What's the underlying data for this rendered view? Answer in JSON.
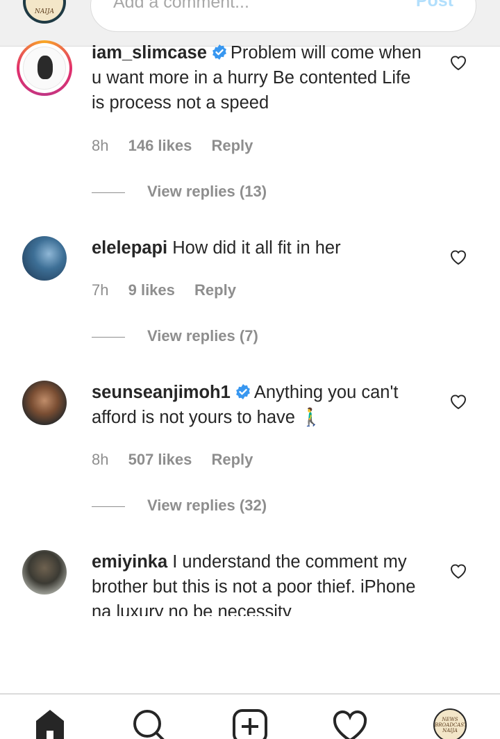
{
  "top_bar": {
    "placeholder": "Add a comment...",
    "post_label": "Post",
    "avatar_text": "NAIJA"
  },
  "comments": [
    {
      "username": "iam_slimcase",
      "verified": true,
      "text": "Problem will come when u want more in a hurry Be contented Life is process not a speed",
      "time": "8h",
      "likes": "146 likes",
      "reply": "Reply",
      "view_replies": "View replies (13)"
    },
    {
      "username": "elelepapi",
      "verified": false,
      "text": "How did it all fit in her",
      "time": "7h",
      "likes": "9 likes",
      "reply": "Reply",
      "view_replies": "View replies (7)"
    },
    {
      "username": "seunseanjimoh1",
      "verified": true,
      "text": "Anything you can't afford is not yours to have 🚶‍♂️",
      "time": "8h",
      "likes": "507 likes",
      "reply": "Reply",
      "view_replies": "View replies (32)"
    },
    {
      "username": "emiyinka",
      "verified": false,
      "text": "I understand the comment my brother but this is not a poor thief. iPhone na luxury no be necessity"
    }
  ],
  "bottom_nav": {
    "items": [
      "home-icon",
      "search-icon",
      "new-post-icon",
      "activity-heart-icon",
      "profile-avatar"
    ],
    "profile_text": "NEWS BROADCAST NAIJA"
  },
  "colors": {
    "verified": "#3897f0",
    "secondary_text": "#8e8e8e",
    "post_disabled": "#b2dffc"
  }
}
